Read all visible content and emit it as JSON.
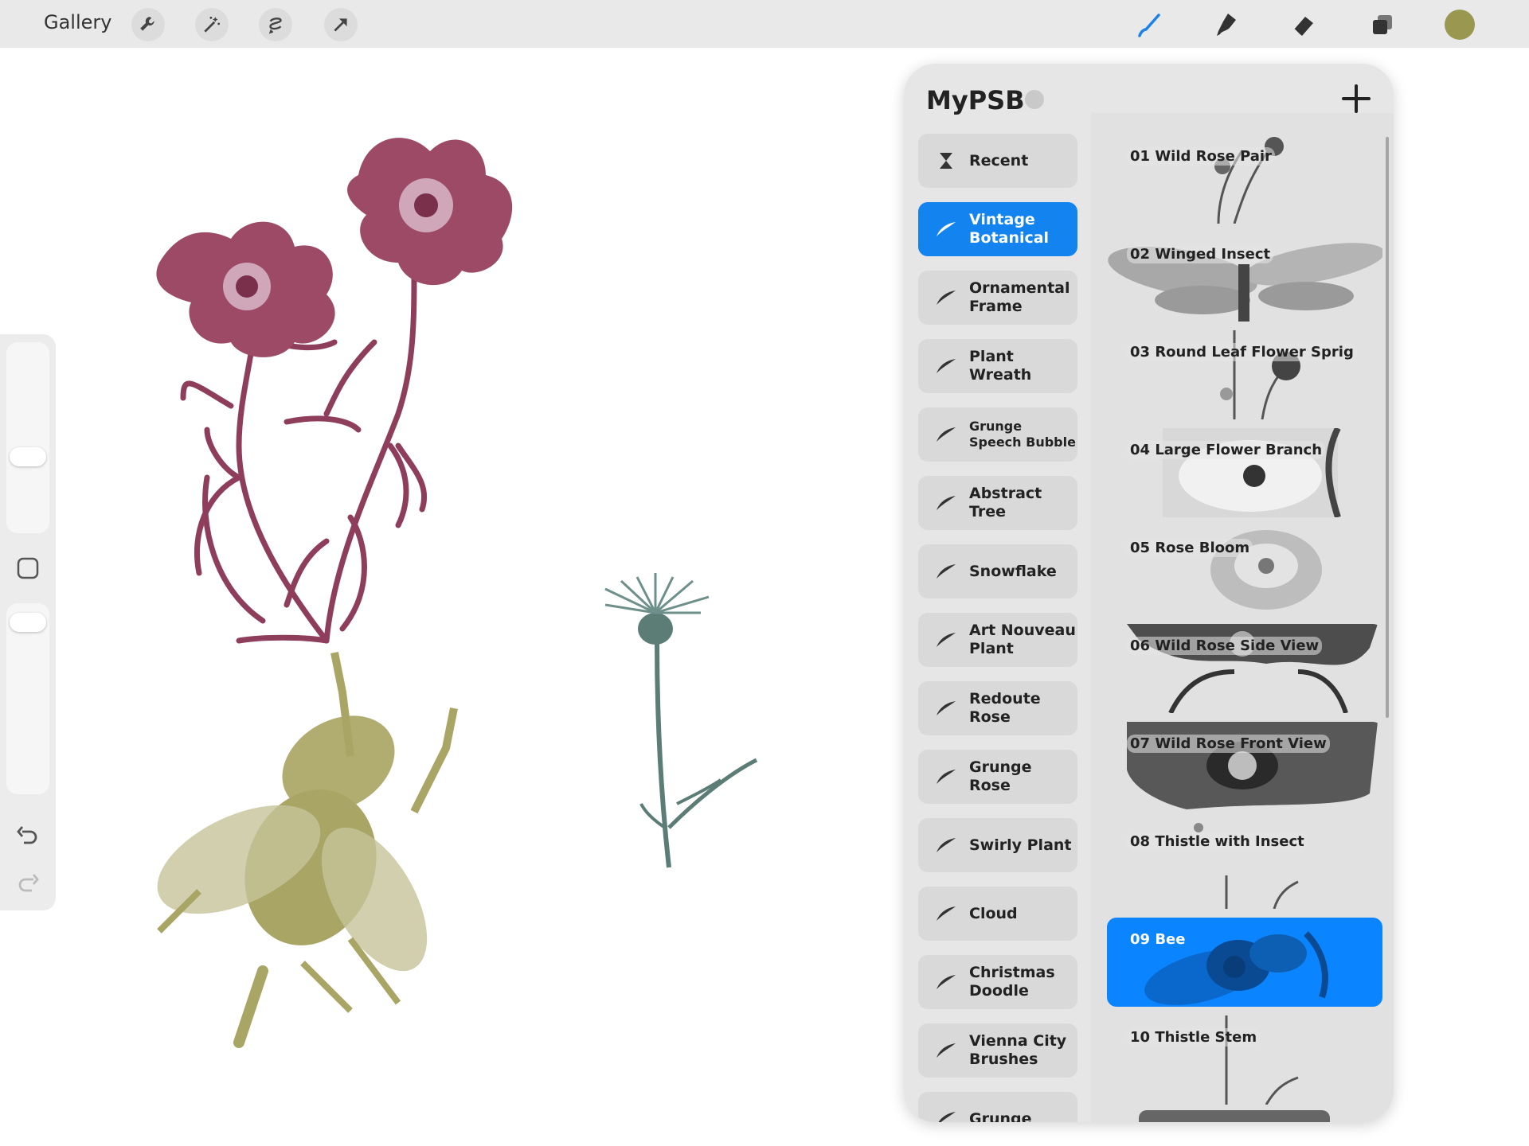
{
  "topbar": {
    "gallery_label": "Gallery",
    "left_tools": [
      "wrench-icon",
      "magic-wand-icon",
      "selection-icon",
      "transform-arrow-icon"
    ],
    "right_tools": [
      "brush-icon",
      "smudge-icon",
      "eraser-icon",
      "layers-icon"
    ],
    "current_color": "#9a9751"
  },
  "panel": {
    "title": "MyPSB",
    "categories": [
      {
        "label": "Recent",
        "icon": "hourglass-icon"
      },
      {
        "label": "Vintage\nBotanical",
        "icon": "brush-stroke-icon",
        "active": true
      },
      {
        "label": "Ornamental\nFrame",
        "icon": "brush-stroke-icon"
      },
      {
        "label": "Plant Wreath",
        "icon": "brush-stroke-icon"
      },
      {
        "label": "Grunge\nSpeech Bubble",
        "icon": "brush-stroke-icon"
      },
      {
        "label": "Abstract\nTree",
        "icon": "brush-stroke-icon"
      },
      {
        "label": "Snowflake",
        "icon": "brush-stroke-icon"
      },
      {
        "label": "Art Nouveau\nPlant",
        "icon": "brush-stroke-icon"
      },
      {
        "label": "Redoute\nRose",
        "icon": "brush-stroke-icon"
      },
      {
        "label": "Grunge Rose",
        "icon": "brush-stroke-icon"
      },
      {
        "label": "Swirly Plant",
        "icon": "brush-stroke-icon"
      },
      {
        "label": "Cloud",
        "icon": "brush-stroke-icon"
      },
      {
        "label": "Christmas\nDoodle",
        "icon": "brush-stroke-icon"
      },
      {
        "label": "Vienna City\nBrushes",
        "icon": "brush-stroke-icon"
      },
      {
        "label": "Grunge",
        "icon": "brush-stroke-icon"
      }
    ],
    "brushes": [
      {
        "label": "01 Wild Rose Pair"
      },
      {
        "label": "02 Winged Insect"
      },
      {
        "label": "03 Round Leaf Flower Sprig"
      },
      {
        "label": "04 Large Flower Branch"
      },
      {
        "label": "05 Rose Bloom"
      },
      {
        "label": "06 Wild Rose Side View"
      },
      {
        "label": "07 Wild Rose Front View"
      },
      {
        "label": "08 Thistle with Insect"
      },
      {
        "label": "09 Bee",
        "active": true
      },
      {
        "label": "10 Thistle Stem"
      }
    ]
  },
  "leftbar": {
    "size_slider": "brush-size-slider",
    "opacity_slider": "opacity-slider",
    "modify_button": "square-modify-icon",
    "undo": "undo-icon",
    "redo": "redo-icon"
  },
  "colors": {
    "accent": "#1283ef",
    "flower": "#9c4a66",
    "bee": "#b1ad71",
    "thistle": "#5b7d76"
  }
}
